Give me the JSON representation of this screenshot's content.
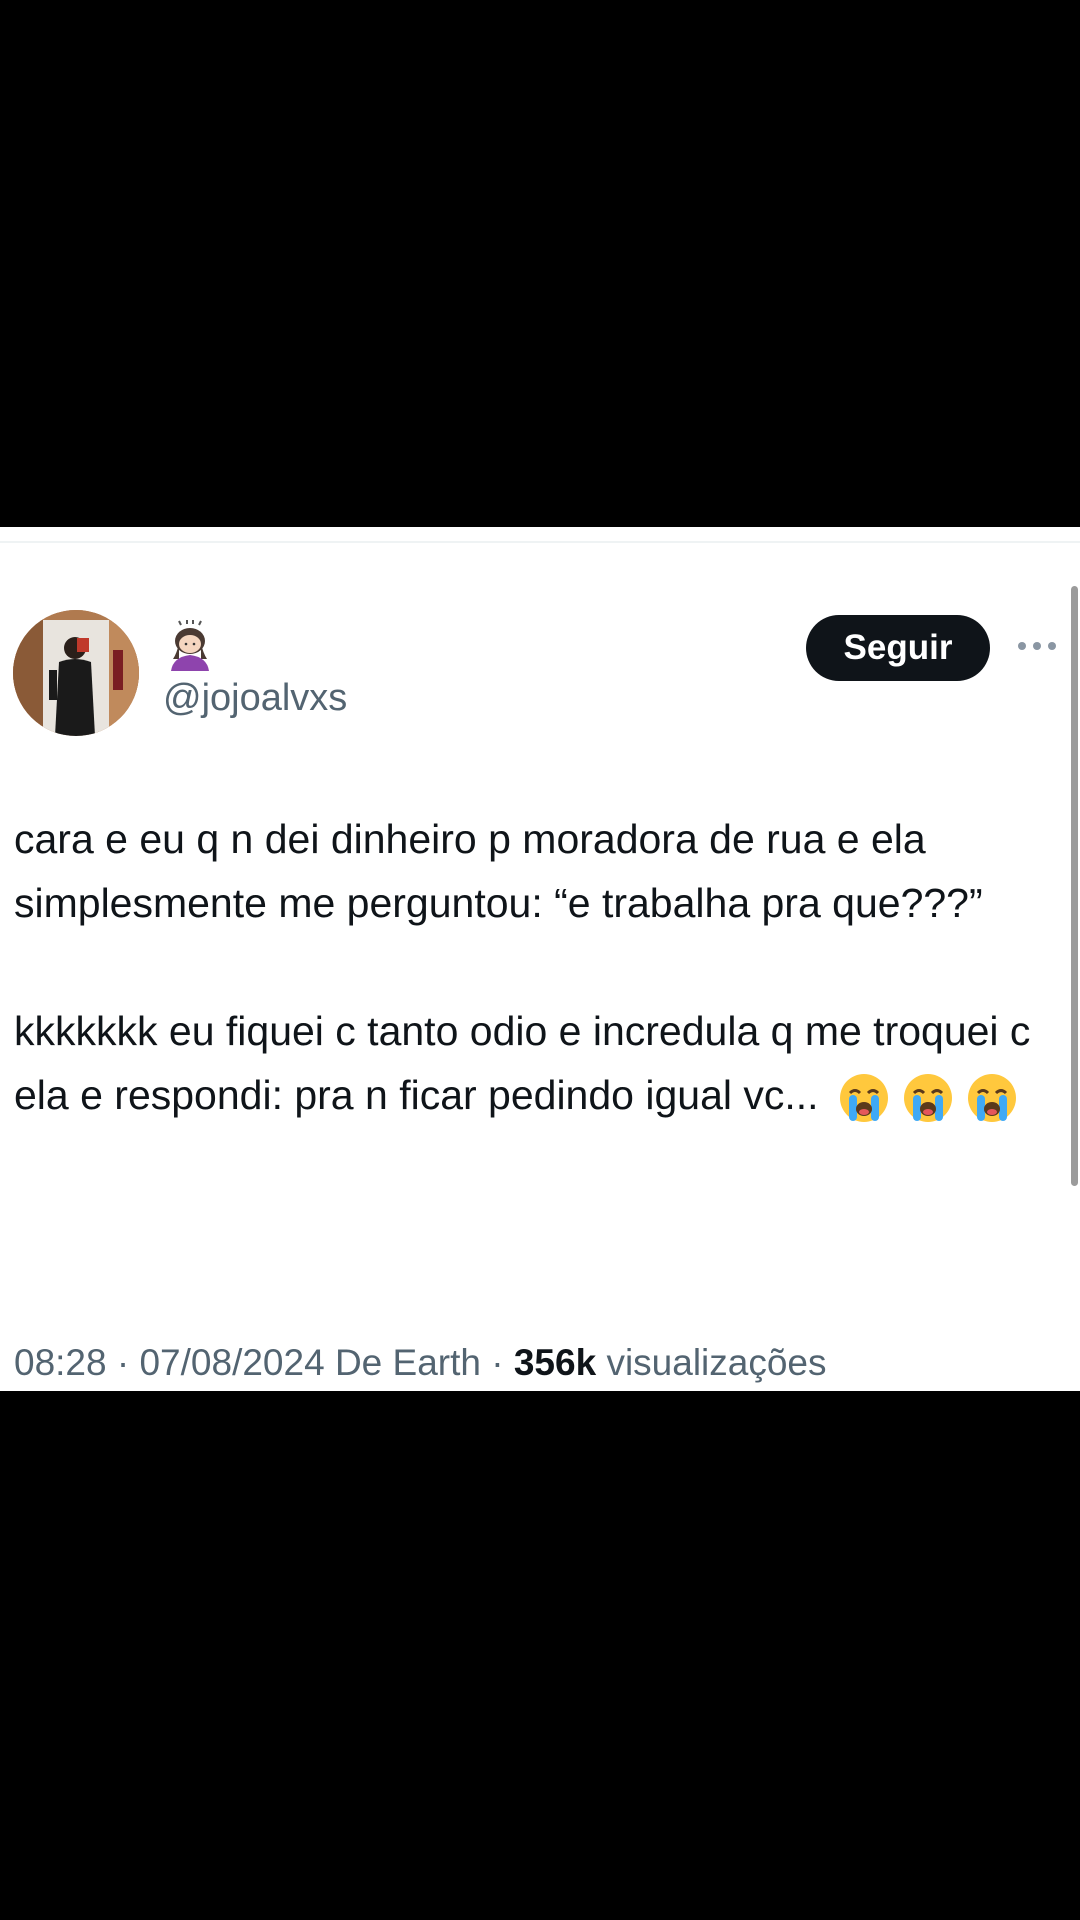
{
  "tweet": {
    "handle": "@jojoalvxs",
    "display_name_emoji": "woman-bowing-emoji",
    "follow_label": "Seguir",
    "more_icon": "more-horizontal-icon",
    "paragraph1": "cara e eu q n dei dinheiro p moradora de rua e ela simplesmente me perguntou: “e trabalha pra que???”",
    "paragraph2": "kkkkkkk eu fiquei c tanto odio e incredula q me troquei c ela e respondi: pra n ficar pedindo igual vc...",
    "trailing_emojis": [
      "loudly-crying-face",
      "loudly-crying-face",
      "loudly-crying-face"
    ],
    "time": "08:28",
    "date": "07/08/2024",
    "location": "De Earth",
    "views_count": "356k",
    "views_label": "visualizações",
    "separator": "·"
  },
  "colors": {
    "background": "#000000",
    "card": "#ffffff",
    "text_primary": "#0f1419",
    "text_secondary": "#536471",
    "follow_button_bg": "#0f1419",
    "follow_button_text": "#ffffff"
  }
}
